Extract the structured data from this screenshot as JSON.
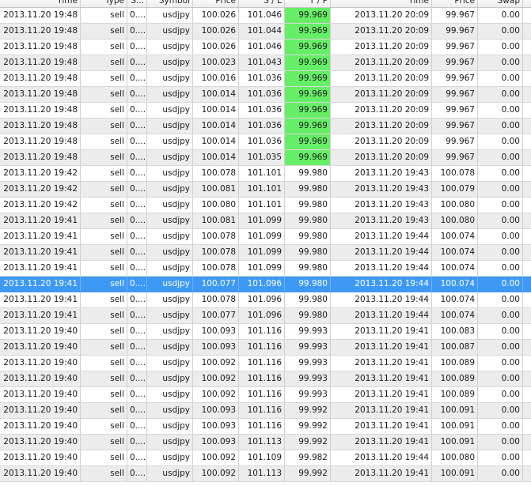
{
  "columns": [
    "Time",
    "Type",
    "S...",
    "Symbol",
    "Price",
    "S / L",
    "T / P",
    "Time",
    "Price",
    "Swap"
  ],
  "selected_row": 17,
  "highlight_color": "#66ee66",
  "rows": [
    [
      "2013.11.20 19:48",
      "sell",
      "0....",
      "usdjpy",
      "100.026",
      "101.046",
      "99.969",
      "2013.11.20 20:09",
      "99.967",
      "0.00"
    ],
    [
      "2013.11.20 19:48",
      "sell",
      "0....",
      "usdjpy",
      "100.026",
      "101.044",
      "99.969",
      "2013.11.20 20:09",
      "99.967",
      "0.00"
    ],
    [
      "2013.11.20 19:48",
      "sell",
      "0....",
      "usdjpy",
      "100.026",
      "101.046",
      "99.969",
      "2013.11.20 20:09",
      "99.967",
      "0.00"
    ],
    [
      "2013.11.20 19:48",
      "sell",
      "0....",
      "usdjpy",
      "100.023",
      "101.043",
      "99.969",
      "2013.11.20 20:09",
      "99.967",
      "0.00"
    ],
    [
      "2013.11.20 19:48",
      "sell",
      "0....",
      "usdjpy",
      "100.016",
      "101.036",
      "99.969",
      "2013.11.20 20:09",
      "99.967",
      "0.00"
    ],
    [
      "2013.11.20 19:48",
      "sell",
      "0....",
      "usdjpy",
      "100.014",
      "101.036",
      "99.969",
      "2013.11.20 20:09",
      "99.967",
      "0.00"
    ],
    [
      "2013.11.20 19:48",
      "sell",
      "0....",
      "usdjpy",
      "100.014",
      "101.036",
      "99.969",
      "2013.11.20 20:09",
      "99.967",
      "0.00"
    ],
    [
      "2013.11.20 19:48",
      "sell",
      "0....",
      "usdjpy",
      "100.014",
      "101.036",
      "99.969",
      "2013.11.20 20:09",
      "99.967",
      "0.00"
    ],
    [
      "2013.11.20 19:48",
      "sell",
      "0....",
      "usdjpy",
      "100.014",
      "101.036",
      "99.969",
      "2013.11.20 20:09",
      "99.967",
      "0.00"
    ],
    [
      "2013.11.20 19:48",
      "sell",
      "0....",
      "usdjpy",
      "100.014",
      "101.035",
      "99.969",
      "2013.11.20 20:09",
      "99.967",
      "0.00"
    ],
    [
      "2013.11.20 19:42",
      "sell",
      "0....",
      "usdjpy",
      "100.078",
      "101.101",
      "99.980",
      "2013.11.20 19:43",
      "100.078",
      "0.00"
    ],
    [
      "2013.11.20 19:42",
      "sell",
      "0....",
      "usdjpy",
      "100.081",
      "101.101",
      "99.980",
      "2013.11.20 19:43",
      "100.079",
      "0.00"
    ],
    [
      "2013.11.20 19:42",
      "sell",
      "0....",
      "usdjpy",
      "100.080",
      "101.101",
      "99.980",
      "2013.11.20 19:43",
      "100.080",
      "0.00"
    ],
    [
      "2013.11.20 19:41",
      "sell",
      "0....",
      "usdjpy",
      "100.081",
      "101.099",
      "99.980",
      "2013.11.20 19:43",
      "100.080",
      "0.00"
    ],
    [
      "2013.11.20 19:41",
      "sell",
      "0....",
      "usdjpy",
      "100.078",
      "101.099",
      "99.980",
      "2013.11.20 19:44",
      "100.074",
      "0.00"
    ],
    [
      "2013.11.20 19:41",
      "sell",
      "0....",
      "usdjpy",
      "100.078",
      "101.099",
      "99.980",
      "2013.11.20 19:44",
      "100.074",
      "0.00"
    ],
    [
      "2013.11.20 19:41",
      "sell",
      "0....",
      "usdjpy",
      "100.078",
      "101.099",
      "99.980",
      "2013.11.20 19:44",
      "100.074",
      "0.00"
    ],
    [
      "2013.11.20 19:41",
      "sell",
      "0....",
      "usdjpy",
      "100.077",
      "101.096",
      "99.980",
      "2013.11.20 19:44",
      "100.074",
      "0.00"
    ],
    [
      "2013.11.20 19:41",
      "sell",
      "0....",
      "usdjpy",
      "100.078",
      "101.096",
      "99.980",
      "2013.11.20 19:44",
      "100.074",
      "0.00"
    ],
    [
      "2013.11.20 19:41",
      "sell",
      "0....",
      "usdjpy",
      "100.077",
      "101.096",
      "99.980",
      "2013.11.20 19:44",
      "100.074",
      "0.00"
    ],
    [
      "2013.11.20 19:40",
      "sell",
      "0....",
      "usdjpy",
      "100.093",
      "101.116",
      "99.993",
      "2013.11.20 19:41",
      "100.083",
      "0.00"
    ],
    [
      "2013.11.20 19:40",
      "sell",
      "0....",
      "usdjpy",
      "100.093",
      "101.116",
      "99.993",
      "2013.11.20 19:41",
      "100.087",
      "0.00"
    ],
    [
      "2013.11.20 19:40",
      "sell",
      "0....",
      "usdjpy",
      "100.092",
      "101.116",
      "99.993",
      "2013.11.20 19:41",
      "100.089",
      "0.00"
    ],
    [
      "2013.11.20 19:40",
      "sell",
      "0....",
      "usdjpy",
      "100.092",
      "101.116",
      "99.993",
      "2013.11.20 19:41",
      "100.089",
      "0.00"
    ],
    [
      "2013.11.20 19:40",
      "sell",
      "0....",
      "usdjpy",
      "100.092",
      "101.116",
      "99.993",
      "2013.11.20 19:41",
      "100.089",
      "0.00"
    ],
    [
      "2013.11.20 19:40",
      "sell",
      "0....",
      "usdjpy",
      "100.093",
      "101.116",
      "99.992",
      "2013.11.20 19:41",
      "100.091",
      "0.00"
    ],
    [
      "2013.11.20 19:40",
      "sell",
      "0....",
      "usdjpy",
      "100.093",
      "101.116",
      "99.992",
      "2013.11.20 19:41",
      "100.091",
      "0.00"
    ],
    [
      "2013.11.20 19:40",
      "sell",
      "0....",
      "usdjpy",
      "100.093",
      "101.113",
      "99.992",
      "2013.11.20 19:41",
      "100.091",
      "0.00"
    ],
    [
      "2013.11.20 19:40",
      "sell",
      "0....",
      "usdjpy",
      "100.092",
      "101.109",
      "99.982",
      "2013.11.20 19:44",
      "100.080",
      "0.00"
    ],
    [
      "2013.11.20 19:40",
      "sell",
      "0....",
      "usdjpy",
      "100.092",
      "101.113",
      "99.992",
      "2013.11.20 19:41",
      "100.091",
      "0.00"
    ]
  ],
  "highlighted_tp_rows": [
    0,
    1,
    2,
    3,
    4,
    5,
    6,
    7,
    8,
    9
  ]
}
